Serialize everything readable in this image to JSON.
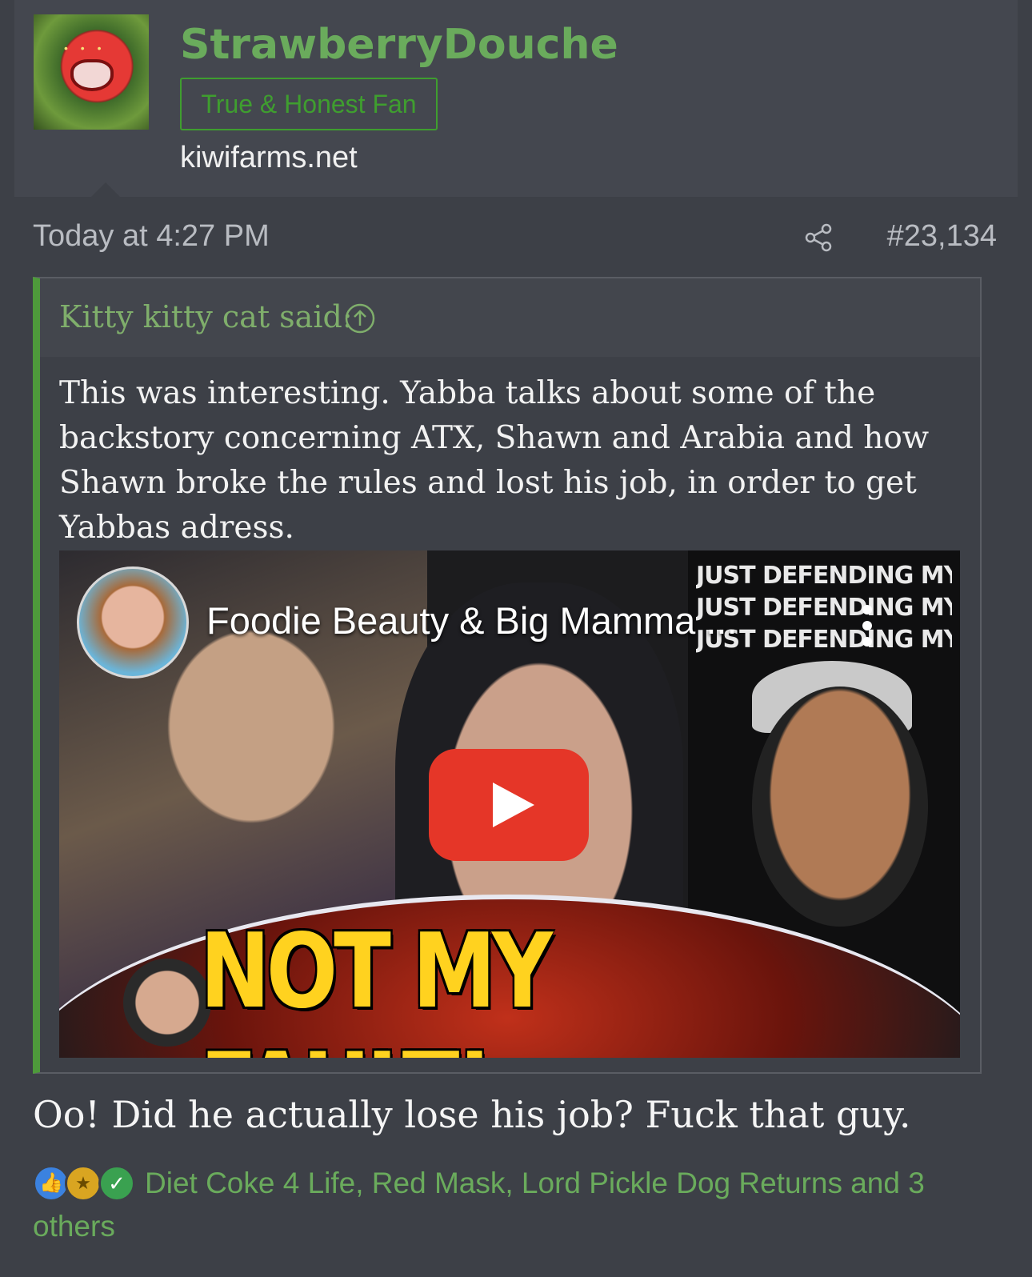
{
  "user": {
    "name": "StrawberryDouche",
    "title": "True & Honest Fan",
    "site": "kiwifarms.net"
  },
  "post": {
    "date": "Today at 4:27 PM",
    "number": "#23,134",
    "body": "Oo! Did he actually lose his job? Fuck that guy."
  },
  "quote": {
    "author": "Kitty kitty cat said:",
    "text": "This was interesting. Yabba talks about some of the backstory concerning ATX, Shawn and Arabia and how Shawn broke the rules and lost his job, in order to get Yabbas adress."
  },
  "video": {
    "channel_title": "Foodie Beauty & Big Mamma ...",
    "thumbnail_caption": "NOT MY FAULT!",
    "wall_text": [
      "JUST DEFENDING MYSELF",
      "JUST DEFENDING MYSELF",
      "JUST DEFENDING MYSELF"
    ]
  },
  "reactions": {
    "icons": [
      "like-icon",
      "medal-icon",
      "check-icon"
    ],
    "text": "Diet Coke 4 Life, Red Mask, Lord Pickle Dog Returns and 3 others"
  },
  "colors": {
    "accent_green": "#6aab5c",
    "badge_green": "#3f9e2f",
    "quote_bar": "#4e9a3b",
    "background": "#3d4047",
    "youtube_red": "#e53628"
  }
}
